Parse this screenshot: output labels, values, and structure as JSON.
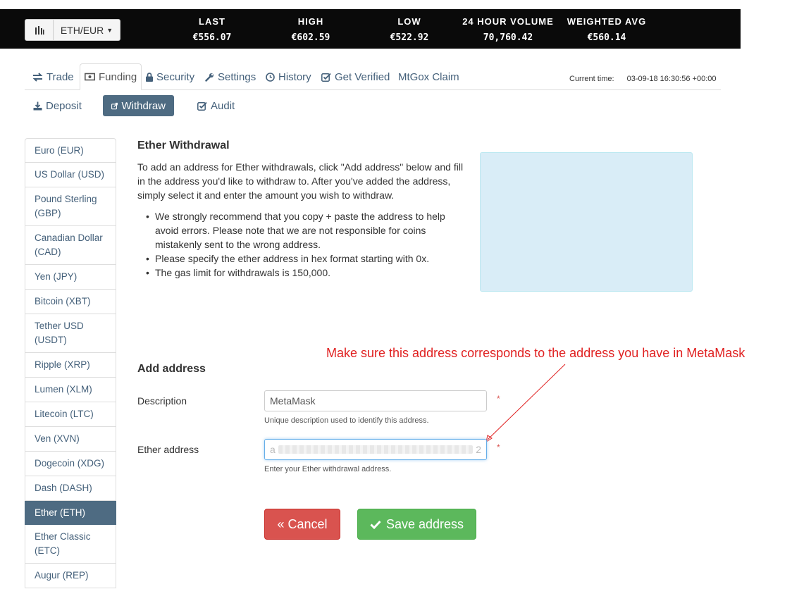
{
  "ticker": {
    "pair": "ETH/EUR",
    "stats": [
      {
        "label": "LAST",
        "value": "€556.07"
      },
      {
        "label": "HIGH",
        "value": "€602.59"
      },
      {
        "label": "LOW",
        "value": "€522.92"
      },
      {
        "label": "24 HOUR VOLUME",
        "value": "70,760.42"
      },
      {
        "label": "WEIGHTED AVG",
        "value": "€560.14"
      }
    ]
  },
  "tabs": {
    "trade": "Trade",
    "funding": "Funding",
    "security": "Security",
    "settings": "Settings",
    "history": "History",
    "get_verified": "Get Verified",
    "mtgox": "MtGox Claim"
  },
  "current_time": {
    "label": "Current time:",
    "value": "03-09-18 16:30:56 +00:00"
  },
  "subtabs": {
    "deposit": "Deposit",
    "withdraw": "Withdraw",
    "audit": "Audit"
  },
  "sidebar": {
    "items": [
      {
        "label": "Euro (EUR)"
      },
      {
        "label": "US Dollar (USD)"
      },
      {
        "label": "Pound Sterling (GBP)"
      },
      {
        "label": "Canadian Dollar (CAD)"
      },
      {
        "label": "Yen (JPY)"
      },
      {
        "label": "Bitcoin (XBT)"
      },
      {
        "label": "Tether USD (USDT)"
      },
      {
        "label": "Ripple (XRP)"
      },
      {
        "label": "Lumen (XLM)"
      },
      {
        "label": "Litecoin (LTC)"
      },
      {
        "label": "Ven (XVN)"
      },
      {
        "label": "Dogecoin (XDG)"
      },
      {
        "label": "Dash (DASH)"
      },
      {
        "label": "Ether (ETH)"
      },
      {
        "label": "Ether Classic (ETC)"
      },
      {
        "label": "Augur (REP)"
      }
    ],
    "active": "Ether (ETH)"
  },
  "main": {
    "title": "Ether Withdrawal",
    "intro": "To add an address for Ether withdrawals, click \"Add address\" below and fill in the address you'd like to withdraw to. After you've added the address, simply select it and enter the amount you wish to withdraw.",
    "bullets": [
      "We strongly recommend that you copy + paste the address to help avoid errors. Please note that we are not responsible for coins mistakenly sent to the wrong address.",
      "Please specify the ether address in hex format starting with 0x.",
      "The gas limit for withdrawals is 150,000."
    ]
  },
  "annotation": "Make sure this address corresponds to the address you have in MetaMask",
  "form": {
    "title": "Add address",
    "description_label": "Description",
    "description_value": "MetaMask",
    "description_help": "Unique description used to identify this address.",
    "address_label": "Ether address",
    "address_value_start": "a",
    "address_value_end": "2",
    "address_help": "Enter your Ether withdrawal address.",
    "required_mark": "*",
    "cancel_label": "« Cancel",
    "save_label": "Save address"
  },
  "colors": {
    "accent": "#4e6b82",
    "cancel": "#d9534f",
    "save": "#5cb85c",
    "annotation": "#e02020"
  }
}
